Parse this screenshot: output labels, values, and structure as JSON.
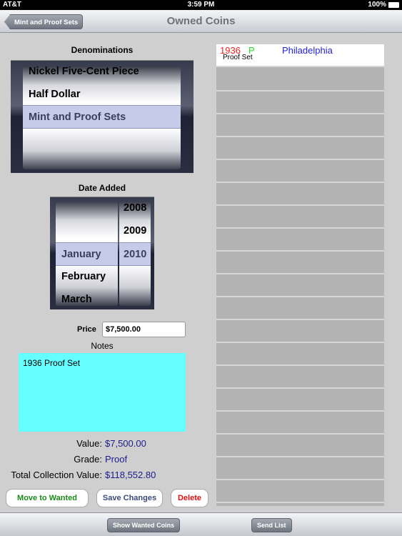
{
  "status": {
    "carrier": "AT&T",
    "time": "3:59 PM",
    "battery": "100%"
  },
  "nav": {
    "back": "Mint and Proof Sets",
    "title": "Owned Coins"
  },
  "denominations": {
    "label": "Denominations",
    "items": [
      "Nickel Five-Cent Piece",
      "Half Dollar",
      "Mint and Proof Sets",
      ""
    ],
    "selected": "Mint and Proof Sets"
  },
  "date_added": {
    "label": "Date Added",
    "months": [
      "January",
      "February",
      "March"
    ],
    "years": [
      "2008",
      "2009",
      "2010"
    ],
    "selected_month": "January",
    "selected_year": "2010"
  },
  "price": {
    "label": "Price",
    "value": "$7,500.00"
  },
  "notes": {
    "label": "Notes",
    "value": "1936 Proof Set"
  },
  "info": {
    "value_label": "Value:",
    "value": "$7,500.00",
    "grade_label": "Grade:",
    "grade": "Proof",
    "total_label": "Total Collection Value:",
    "total": "$118,552.80"
  },
  "buttons": {
    "move": "Move to Wanted",
    "save": "Save Changes",
    "delete": "Delete"
  },
  "toolbar": {
    "show_wanted": "Show Wanted Coins",
    "send": "Send List"
  },
  "coins": [
    {
      "year": "1936",
      "mint": "P",
      "mint_name": "Philadelphia",
      "desc": "Proof Set"
    }
  ],
  "colors": {
    "year": "#ee2222",
    "mint": "#22dd22",
    "mint_name": "#2222dd",
    "notes_bg": "#66ffff",
    "value": "#1c1c8c",
    "move": "#1a8a1a",
    "save": "#3a4a7a",
    "delete": "#e01010"
  }
}
